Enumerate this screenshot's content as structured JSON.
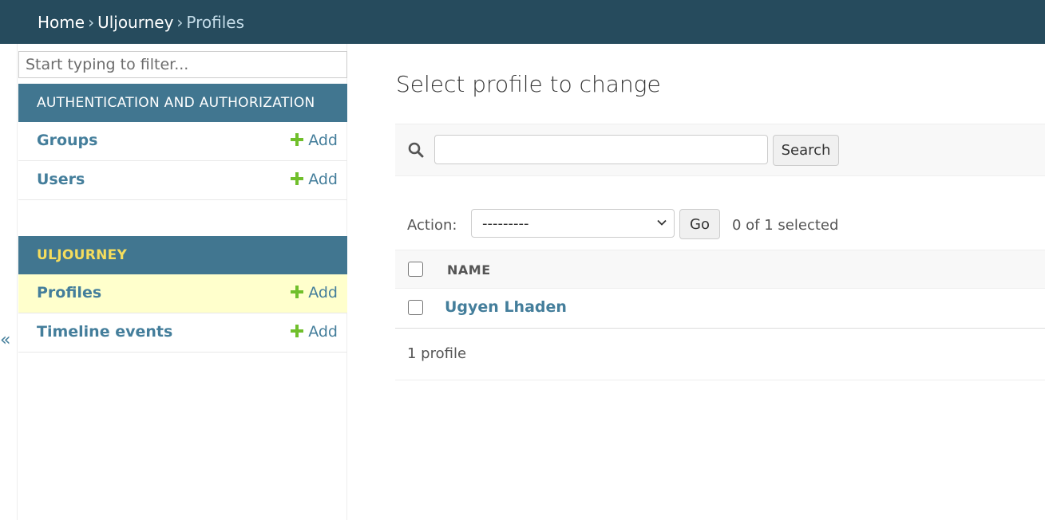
{
  "breadcrumbs": {
    "home": "Home",
    "separator": "›",
    "app": "Uljourney",
    "current": "Profiles"
  },
  "sidebar": {
    "filter_placeholder": "Start typing to filter...",
    "collapse_toggle": "«",
    "modules": [
      {
        "caption": "AUTHENTICATION AND AUTHORIZATION",
        "models": [
          {
            "name": "Groups",
            "add_label": "Add"
          },
          {
            "name": "Users",
            "add_label": "Add"
          }
        ]
      },
      {
        "caption": "ULJOURNEY",
        "models": [
          {
            "name": "Profiles",
            "add_label": "Add",
            "active": true
          },
          {
            "name": "Timeline events",
            "add_label": "Add"
          }
        ]
      }
    ]
  },
  "main": {
    "title": "Select profile to change",
    "search": {
      "value": "",
      "button_label": "Search"
    },
    "actions": {
      "label": "Action:",
      "selected_option": "---------",
      "go_label": "Go",
      "selection_count": "0 of 1 selected"
    },
    "table": {
      "columns": [
        "NAME"
      ],
      "rows": [
        {
          "name": "Ugyen Lhaden"
        }
      ]
    },
    "paginator": "1 profile"
  },
  "colors": {
    "header_bg": "#264b5d",
    "module_caption_bg": "#417690",
    "link": "#447e9b",
    "active_row": "#ffffcc",
    "add_icon": "#70bf2b",
    "module_caption_current": "#f5dd5d"
  },
  "icons": [
    "search-icon",
    "plus-icon",
    "chevron-down-icon",
    "checkbox"
  ]
}
